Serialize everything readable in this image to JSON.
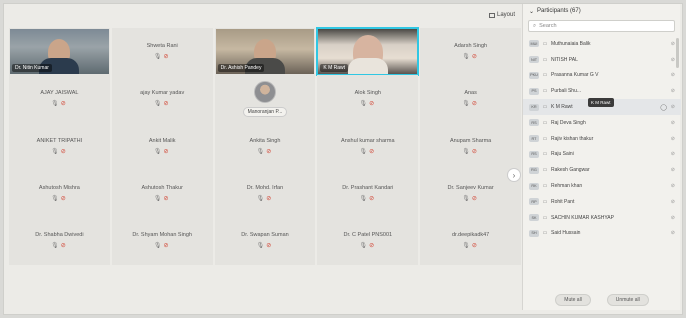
{
  "toolbar": {
    "layout_label": "Layout"
  },
  "grid": {
    "tiles": [
      {
        "kind": "video",
        "variant": "v1",
        "label": "Dr. Nitin Kumar",
        "highlight": false
      },
      {
        "kind": "name",
        "name": "Shweta Rani"
      },
      {
        "kind": "video",
        "variant": "v2",
        "label": "Dr. Ashish Pandey",
        "highlight": false
      },
      {
        "kind": "video",
        "variant": "v3",
        "label": "K M Rawt",
        "highlight": true
      },
      {
        "kind": "name",
        "name": "Adarsh Singh"
      },
      {
        "kind": "name",
        "name": "AJAY JAISWAL"
      },
      {
        "kind": "name",
        "name": "ajay Kumar yadav"
      },
      {
        "kind": "avatar",
        "pill": "Manoranjan P..."
      },
      {
        "kind": "name",
        "name": "Alok Singh"
      },
      {
        "kind": "name",
        "name": "Anas"
      },
      {
        "kind": "name",
        "name": "ANIKET TRIPATHI"
      },
      {
        "kind": "name",
        "name": "Ankit Malik"
      },
      {
        "kind": "name",
        "name": "Ankita Singh"
      },
      {
        "kind": "name",
        "name": "Anshul kumar sharma"
      },
      {
        "kind": "name",
        "name": "Anupam Sharma"
      },
      {
        "kind": "name",
        "name": "Ashutosh Mishra"
      },
      {
        "kind": "name",
        "name": "Ashutosh Thakur"
      },
      {
        "kind": "name",
        "name": "Dr. Mohd. Irfan"
      },
      {
        "kind": "name",
        "name": "Dr. Prashant Kandari"
      },
      {
        "kind": "name",
        "name": "Dr. Sanjeev Kumar"
      },
      {
        "kind": "name",
        "name": "Dr. Shabha Dwivedi"
      },
      {
        "kind": "name",
        "name": "Dr. Shyam Mohan Singh"
      },
      {
        "kind": "name",
        "name": "Dr. Swapan Suman"
      },
      {
        "kind": "name",
        "name": "Dr. C Patel PNS001"
      },
      {
        "kind": "name",
        "name": "dr.deepikadk47"
      }
    ]
  },
  "participants": {
    "title": "Participants (67)",
    "search_placeholder": "Search",
    "tooltip": "K M Rawt",
    "items": [
      {
        "badge": "MUI",
        "name": "Muthunaiaia Balik",
        "selected": false
      },
      {
        "badge": "NIT",
        "name": "NITISH PAL",
        "selected": false
      },
      {
        "badge": "PKU",
        "name": "Prasanna Kumar G V",
        "selected": false
      },
      {
        "badge": "PS",
        "name": "Purbali Shu...",
        "selected": false
      },
      {
        "badge": "KR",
        "name": "K M Rawt",
        "selected": true
      },
      {
        "badge": "RS",
        "name": "Raj Deva Singh",
        "selected": false
      },
      {
        "badge": "RT",
        "name": "Rajiv kishan thakur",
        "selected": false
      },
      {
        "badge": "RS",
        "name": "Raju Saini",
        "selected": false
      },
      {
        "badge": "RG",
        "name": "Rakesh Gangwar",
        "selected": false
      },
      {
        "badge": "RK",
        "name": "Rehman khan",
        "selected": false
      },
      {
        "badge": "RP",
        "name": "Rohit Pant",
        "selected": false
      },
      {
        "badge": "SK",
        "name": "SACHIN KUMAR KASHYAP",
        "selected": false
      },
      {
        "badge": "SH",
        "name": "Said Hussain",
        "selected": false
      }
    ],
    "mute_all_label": "Mute all",
    "unmute_all_label": "Unmute all"
  }
}
